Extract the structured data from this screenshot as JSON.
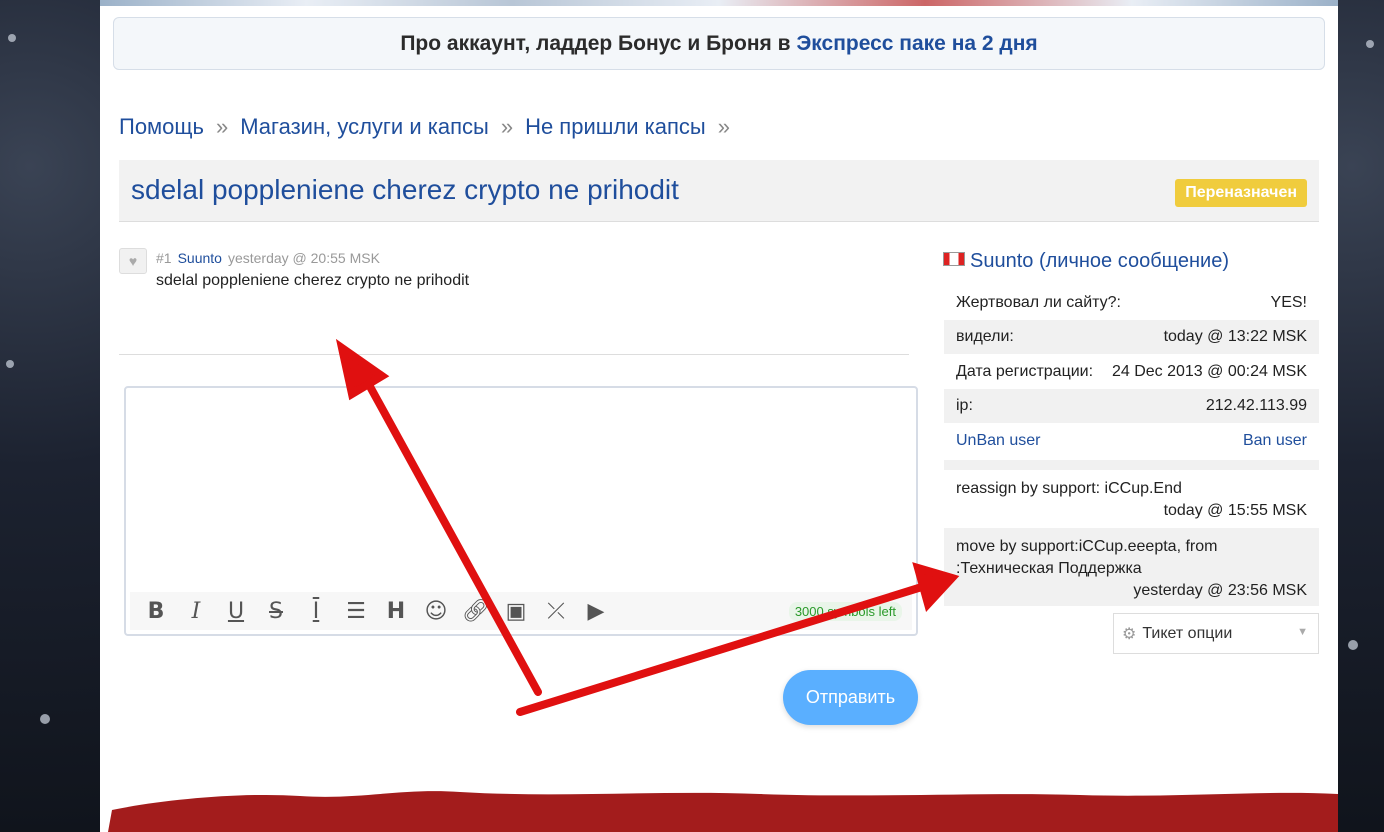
{
  "promo": {
    "text": "Про аккаунт, ладдер Бонус и Броня в ",
    "link": "Экспресс паке на 2 дня"
  },
  "breadcrumb": {
    "items": [
      "Помощь",
      "Магазин, услуги и капсы",
      "Не пришли капсы"
    ],
    "separator": "»"
  },
  "ticket": {
    "title": "sdelal poppleniene cherez crypto ne prihodit",
    "status": "Переназначен",
    "status_color": "#f0cc3d"
  },
  "post": {
    "number": "#1",
    "author": "Suunto",
    "time": "yesterday @ 20:55 MSK",
    "body": "sdelal poppleniene cherez crypto ne prihodit"
  },
  "editor": {
    "counter": "3000 symbols left",
    "tools": [
      "bold-icon",
      "italic-icon",
      "underline-icon",
      "strikethrough-icon",
      "heading-line-icon",
      "list-icon",
      "header-icon",
      "smiley-icon",
      "link-icon",
      "image-icon",
      "collapse-icon",
      "youtube-icon"
    ]
  },
  "send_label": "Отправить",
  "sidebar": {
    "username": "Suunto",
    "pm_label": "(личное сообщение)",
    "rows": {
      "donated_label": "Жертвовал ли сайту?:",
      "donated_value": "YES!",
      "seen_label": "видели:",
      "seen_value": "today @ 13:22 MSK",
      "reg_label": "Дата регистрации:",
      "reg_value": "24 Dec 2013 @ 00:24 MSK",
      "ip_label": "ip:",
      "ip_value": "212.42.113.99",
      "unban": "UnBan user",
      "ban": "Ban user"
    },
    "log": [
      {
        "text": "reassign by support: iCCup.End",
        "time": "today @ 15:55 MSK"
      },
      {
        "text": "move by support:iCCup.eeepta, from :Техническая Поддержка",
        "time": "yesterday @ 23:56 MSK"
      }
    ],
    "ticket_options": "Тикет опции"
  },
  "colors": {
    "link": "#1f4e9c",
    "send_button": "#5aafff",
    "annotation_arrow": "#e01010",
    "footer": "#a31c1c"
  }
}
